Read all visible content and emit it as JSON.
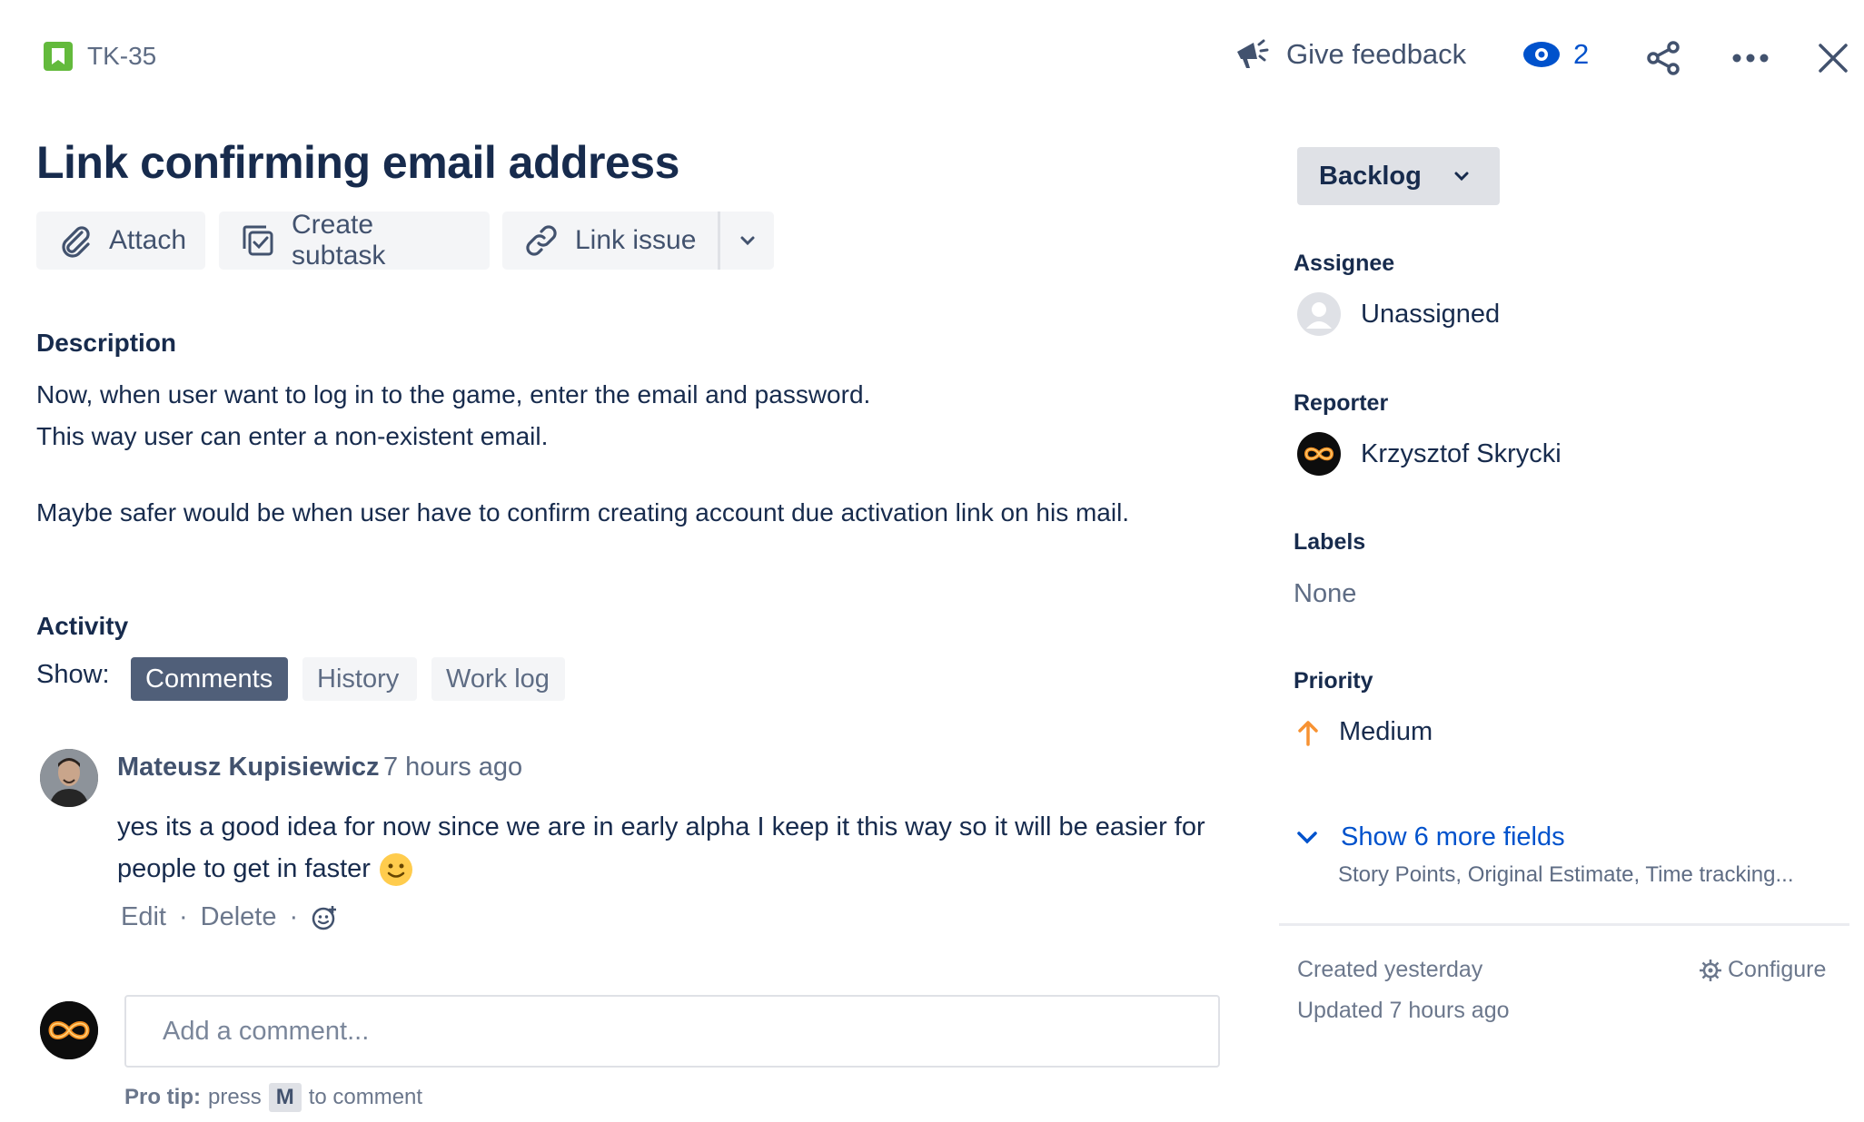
{
  "header": {
    "issue_key": "TK-35",
    "feedback_label": "Give feedback",
    "watchers_count": "2"
  },
  "issue": {
    "title": "Link confirming email address"
  },
  "toolbar": {
    "attach_label": "Attach",
    "subtask_label": "Create subtask",
    "link_label": "Link issue"
  },
  "description": {
    "heading": "Description",
    "line1": "Now, when user want to log in to the game, enter the email and password.",
    "line2": "This way user can enter a non-existent email.",
    "line3": "Maybe safer would be when user have to confirm creating account due activation link on his mail."
  },
  "activity": {
    "heading": "Activity",
    "show_label": "Show:",
    "tabs": [
      "Comments",
      "History",
      "Work log"
    ],
    "active_tab": "Comments"
  },
  "comment": {
    "author": "Mateusz Kupisiewicz",
    "time": "7 hours ago",
    "body": "yes its a good idea for now since we are in early alpha I keep it this way so it will be easier for people to get in faster",
    "edit_label": "Edit",
    "delete_label": "Delete",
    "separator": "·"
  },
  "new_comment": {
    "placeholder": "Add a comment...",
    "protip_bold": "Pro tip:",
    "protip_press": "press",
    "protip_key": "M",
    "protip_tail": "to comment"
  },
  "sidebar": {
    "status": "Backlog",
    "assignee_label": "Assignee",
    "assignee_value": "Unassigned",
    "reporter_label": "Reporter",
    "reporter_value": "Krzysztof Skrycki",
    "labels_label": "Labels",
    "labels_value": "None",
    "priority_label": "Priority",
    "priority_value": "Medium",
    "more_fields_label": "Show 6 more fields",
    "more_fields_sub": "Story Points, Original Estimate, Time tracking...",
    "created": "Created yesterday",
    "updated": "Updated 7 hours ago",
    "configure_label": "Configure"
  },
  "colors": {
    "accent": "#0052cc",
    "story_icon": "#63ba3c",
    "priority_medium": "#f79232",
    "active_tab": "#505f79"
  },
  "icons": [
    "story-icon",
    "megaphone-icon",
    "eye-icon",
    "share-icon",
    "more-icon",
    "close-icon",
    "paperclip-icon",
    "subtask-icon",
    "link-icon",
    "chevron-down-icon",
    "smile-emoji",
    "add-reaction-icon",
    "user-placeholder-icon",
    "arrow-up-icon",
    "gear-icon"
  ]
}
